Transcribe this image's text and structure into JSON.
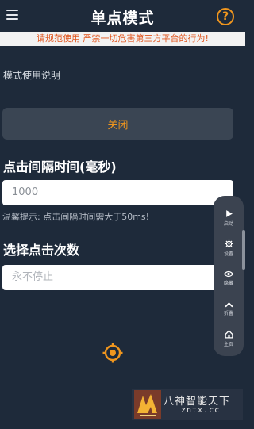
{
  "header": {
    "title": "单点模式",
    "help_label": "?"
  },
  "banner": {
    "text": "请规范使用 严禁一切危害第三方平台的行为!"
  },
  "usage": {
    "label": "模式使用说明"
  },
  "toggle": {
    "label": "关闭"
  },
  "interval": {
    "title": "点击间隔时间(毫秒)",
    "value": "1000",
    "hint": "温馨提示: 点击间隔时间需大于50ms!"
  },
  "count": {
    "title": "选择点击次数",
    "placeholder": "永不停止"
  },
  "float_panel": {
    "items": [
      {
        "label": "启动",
        "icon": "play-icon"
      },
      {
        "label": "设置",
        "icon": "gear-icon"
      },
      {
        "label": "隐藏",
        "icon": "eye-icon"
      },
      {
        "label": "折叠",
        "icon": "chevron-up-icon"
      },
      {
        "label": "主页",
        "icon": "home-icon"
      }
    ]
  },
  "watermark": {
    "name": "八神智能天下",
    "url": "zntx.cc"
  },
  "colors": {
    "background": "#1e2a3a",
    "accent": "#f0961e",
    "banner_text": "#e0551e",
    "button_bg": "#3a4553",
    "panel_bg": "#3b4350"
  }
}
